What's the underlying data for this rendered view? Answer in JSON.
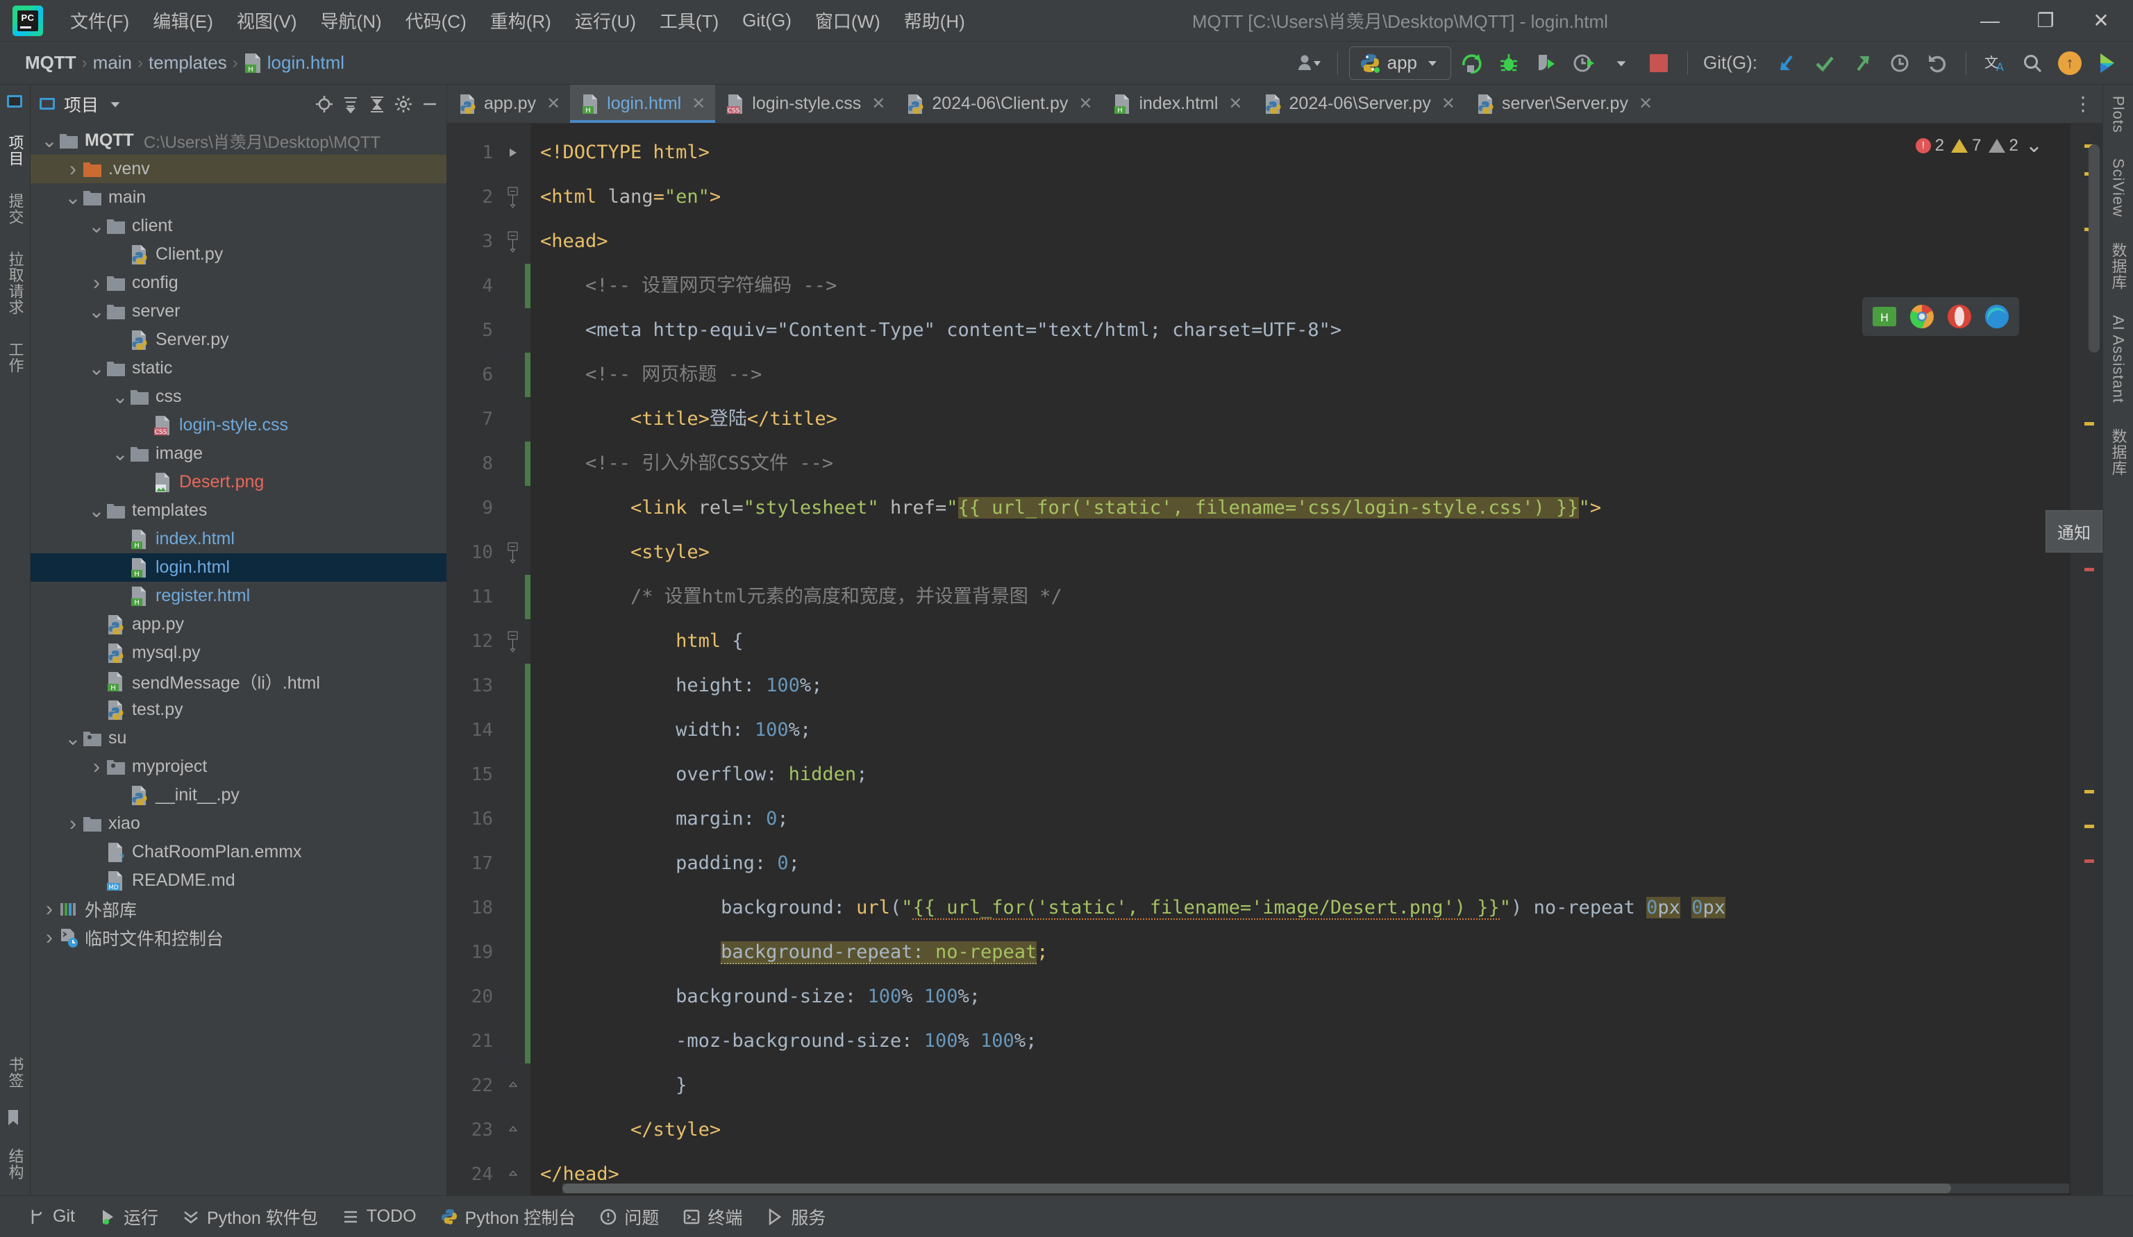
{
  "window": {
    "title": "MQTT [C:\\Users\\肖羡月\\Desktop\\MQTT] - login.html",
    "minimize": "—",
    "maximize": "❐",
    "close": "✕"
  },
  "menubar": {
    "items": [
      {
        "label": "文件(F)"
      },
      {
        "label": "编辑(E)"
      },
      {
        "label": "视图(V)"
      },
      {
        "label": "导航(N)"
      },
      {
        "label": "代码(C)"
      },
      {
        "label": "重构(R)"
      },
      {
        "label": "运行(U)"
      },
      {
        "label": "工具(T)"
      },
      {
        "label": "Git(G)"
      },
      {
        "label": "窗口(W)"
      },
      {
        "label": "帮助(H)"
      }
    ]
  },
  "toolbar": {
    "breadcrumb": [
      "MQTT",
      "main",
      "templates",
      "login.html"
    ],
    "separator": "›",
    "run_config": "app",
    "git_label": "Git(G):",
    "icons": [
      "account-icon",
      "run-icon",
      "debug-icon",
      "coverage-icon",
      "profile-icon",
      "stop-icon",
      "git-update-icon",
      "git-commit-icon",
      "git-push-icon",
      "git-history-icon",
      "git-rollback-icon",
      "translate-icon",
      "search-everywhere-icon",
      "updates-icon",
      "ai-icon"
    ]
  },
  "left_strip": {
    "tabs": [
      "项目",
      "提交",
      "拉取请求",
      "工作"
    ]
  },
  "project_panel": {
    "title": "项目",
    "header_icons": [
      "locate-icon",
      "expand-all-icon",
      "collapse-all-icon",
      "settings-icon",
      "hide-icon"
    ],
    "tree": [
      {
        "depth": 0,
        "arrow": "down",
        "icon": "folder",
        "label": "MQTT",
        "bold": true,
        "sub": "C:\\Users\\肖羡月\\Desktop\\MQTT"
      },
      {
        "depth": 1,
        "arrow": "right",
        "icon": "folder-orange",
        "label": ".venv",
        "state": "inactive-select"
      },
      {
        "depth": 1,
        "arrow": "down",
        "icon": "folder",
        "label": "main"
      },
      {
        "depth": 2,
        "arrow": "down",
        "icon": "folder",
        "label": "client"
      },
      {
        "depth": 3,
        "arrow": "none",
        "icon": "py",
        "label": "Client.py"
      },
      {
        "depth": 2,
        "arrow": "right",
        "icon": "folder",
        "label": "config"
      },
      {
        "depth": 2,
        "arrow": "down",
        "icon": "folder",
        "label": "server"
      },
      {
        "depth": 3,
        "arrow": "none",
        "icon": "py",
        "label": "Server.py"
      },
      {
        "depth": 2,
        "arrow": "down",
        "icon": "folder",
        "label": "static"
      },
      {
        "depth": 3,
        "arrow": "down",
        "icon": "folder",
        "label": "css"
      },
      {
        "depth": 4,
        "arrow": "none",
        "icon": "css",
        "label": "login-style.css",
        "color": "blue"
      },
      {
        "depth": 3,
        "arrow": "down",
        "icon": "folder",
        "label": "image"
      },
      {
        "depth": 4,
        "arrow": "none",
        "icon": "img",
        "label": "Desert.png",
        "color": "red"
      },
      {
        "depth": 2,
        "arrow": "down",
        "icon": "folder",
        "label": "templates"
      },
      {
        "depth": 3,
        "arrow": "none",
        "icon": "html",
        "label": "index.html",
        "color": "blue"
      },
      {
        "depth": 3,
        "arrow": "none",
        "icon": "html",
        "label": "login.html",
        "color": "blue",
        "state": "active-select"
      },
      {
        "depth": 3,
        "arrow": "none",
        "icon": "html",
        "label": "register.html",
        "color": "blue"
      },
      {
        "depth": 2,
        "arrow": "none",
        "icon": "py",
        "label": "app.py"
      },
      {
        "depth": 2,
        "arrow": "none",
        "icon": "py",
        "label": "mysql.py"
      },
      {
        "depth": 2,
        "arrow": "none",
        "icon": "html",
        "label": "sendMessage（li）.html"
      },
      {
        "depth": 2,
        "arrow": "none",
        "icon": "py",
        "label": "test.py"
      },
      {
        "depth": 1,
        "arrow": "down",
        "icon": "folder-src",
        "label": "su"
      },
      {
        "depth": 2,
        "arrow": "right",
        "icon": "folder-src",
        "label": "myproject"
      },
      {
        "depth": 3,
        "arrow": "none",
        "icon": "py",
        "label": "__init__.py"
      },
      {
        "depth": 1,
        "arrow": "right",
        "icon": "folder",
        "label": "xiao"
      },
      {
        "depth": 2,
        "arrow": "none",
        "icon": "unknown",
        "label": "ChatRoomPlan.emmx"
      },
      {
        "depth": 2,
        "arrow": "none",
        "icon": "md",
        "label": "README.md"
      },
      {
        "depth": 0,
        "arrow": "right",
        "icon": "lib",
        "label": "外部库"
      },
      {
        "depth": 0,
        "arrow": "right",
        "icon": "scratch",
        "label": "临时文件和控制台"
      }
    ]
  },
  "editor": {
    "tabs": [
      {
        "label": "app.py",
        "icon": "py",
        "active": false
      },
      {
        "label": "login.html",
        "icon": "html",
        "active": true
      },
      {
        "label": "login-style.css",
        "icon": "css",
        "active": false
      },
      {
        "label": "2024-06\\Client.py",
        "icon": "py",
        "active": false
      },
      {
        "label": "index.html",
        "icon": "html",
        "active": false
      },
      {
        "label": "2024-06\\Server.py",
        "icon": "py",
        "active": false
      },
      {
        "label": "server\\Server.py",
        "icon": "py",
        "active": false
      }
    ],
    "tab_close": "✕",
    "more_tabs": "⋮",
    "inspection": {
      "errors": "2",
      "warnings": "7",
      "weak_warnings": "2",
      "error_icon": "error-circle-icon",
      "warning_icon": "warning-triangle-icon",
      "weak_icon": "weak-warning-triangle-icon",
      "chevron": "⌄"
    },
    "lines": [
      {
        "n": 1,
        "text": "<!DOCTYPE html>"
      },
      {
        "n": 2,
        "text": "<html lang=\"en\">"
      },
      {
        "n": 3,
        "text": "<head>"
      },
      {
        "n": 4,
        "text": "    <!-- 设置网页字符编码 -->"
      },
      {
        "n": 5,
        "text": "    <meta http-equiv=\"Content-Type\" content=\"text/html; charset=UTF-8\">"
      },
      {
        "n": 6,
        "text": "    <!-- 网页标题 -->"
      },
      {
        "n": 7,
        "text": "    <title>登陆</title>"
      },
      {
        "n": 8,
        "text": "    <!-- 引入外部CSS文件 -->"
      },
      {
        "n": 9,
        "text": "    <link rel=\"stylesheet\" href=\"{{ url_for('static', filename='css/login-style.css') }}\">"
      },
      {
        "n": 10,
        "text": "    <style>"
      },
      {
        "n": 11,
        "text": "        /* 设置html元素的高度和宽度，并设置背景图 */"
      },
      {
        "n": 12,
        "text": "        html {"
      },
      {
        "n": 13,
        "text": "            height: 100%;"
      },
      {
        "n": 14,
        "text": "            width: 100%;"
      },
      {
        "n": 15,
        "text": "            overflow: hidden;"
      },
      {
        "n": 16,
        "text": "            margin: 0;"
      },
      {
        "n": 17,
        "text": "            padding: 0;"
      },
      {
        "n": 18,
        "text": "            background: url(\"{{ url_for('static', filename='image/Desert.png') }}\") no-repeat 0px 0px"
      },
      {
        "n": 19,
        "text": "            background-repeat: no-repeat;"
      },
      {
        "n": 20,
        "text": "            background-size: 100% 100%;"
      },
      {
        "n": 21,
        "text": "            -moz-background-size: 100% 100%;"
      },
      {
        "n": 22,
        "text": "        }"
      },
      {
        "n": 23,
        "text": "    </style>"
      },
      {
        "n": 24,
        "text": "</head>"
      },
      {
        "n": 25,
        "text": ""
      }
    ]
  },
  "right_strip": {
    "tabs": [
      "Plots",
      "SciView",
      "数据库",
      "AI Assistant",
      "数据库"
    ],
    "notification": "通知"
  },
  "statusbar": {
    "items": [
      {
        "label": "Git",
        "icon": "git-branch-icon"
      },
      {
        "label": "运行",
        "icon": "run-icon"
      },
      {
        "label": "Python 软件包",
        "icon": "packages-icon"
      },
      {
        "label": "TODO",
        "icon": "todo-icon"
      },
      {
        "label": "Python 控制台",
        "icon": "python-console-icon"
      },
      {
        "label": "问题",
        "icon": "problems-icon"
      },
      {
        "label": "终端",
        "icon": "terminal-icon"
      },
      {
        "label": "服务",
        "icon": "services-icon"
      }
    ]
  },
  "colors": {
    "background": "#3c3f41",
    "editor_bg": "#2b2b2b",
    "accent_blue": "#4a88c7",
    "selection": "#0d293e",
    "keyword": "#e8bf6a",
    "string": "#a5c261",
    "comment": "#808080",
    "number": "#6897bb",
    "highlight": "#5a5330",
    "error_red": "#e05555",
    "warning_yellow": "#d6b33c"
  }
}
